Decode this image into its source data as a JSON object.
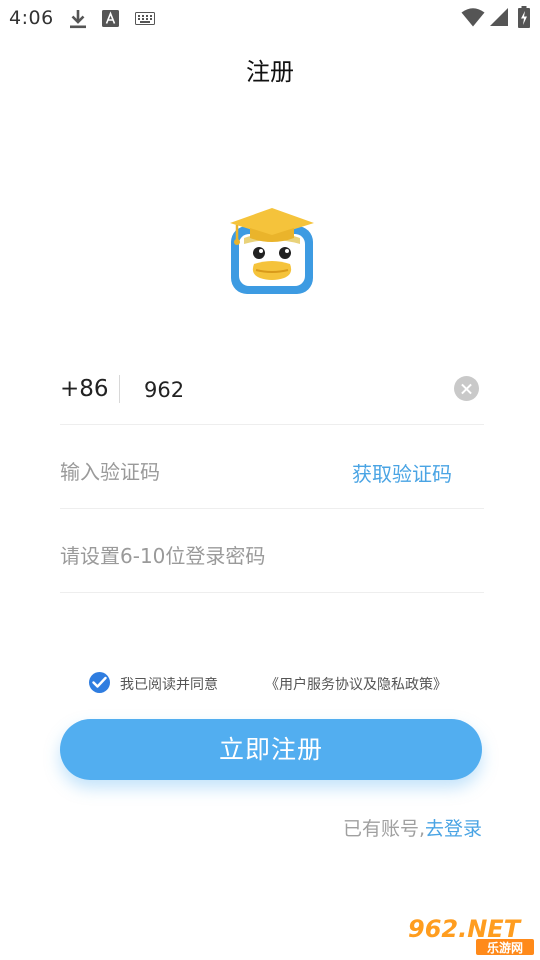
{
  "status_bar": {
    "time": "4:06",
    "left_icons": [
      "download-icon",
      "text-a-icon",
      "keyboard-icon"
    ],
    "right_icons": [
      "wifi-icon",
      "cellular-signal-icon",
      "battery-charging-icon"
    ]
  },
  "page": {
    "title": "注册"
  },
  "logo": {
    "icon": "duck-graduation-cap-logo"
  },
  "form": {
    "country_code": "+86",
    "phone_value": "962",
    "clear_icon": "clear-circle-icon",
    "code_placeholder": "输入验证码",
    "get_code_label": "获取验证码",
    "password_placeholder": "请设置6-10位登录密码"
  },
  "agreement": {
    "checked": true,
    "text": "我已阅读并同意",
    "link": "《用户服务协议及隐私政策》"
  },
  "actions": {
    "register_label": "立即注册",
    "have_account": "已有账号,",
    "go_login": "去登录"
  },
  "watermark": {
    "text": "962.NET",
    "subtext": "乐游网"
  },
  "colors": {
    "accent": "#52aef0",
    "link": "#4aa4e4",
    "checkbox": "#2f7de0",
    "logo_blue": "#3d9be2",
    "logo_yellow": "#f5c33b"
  }
}
